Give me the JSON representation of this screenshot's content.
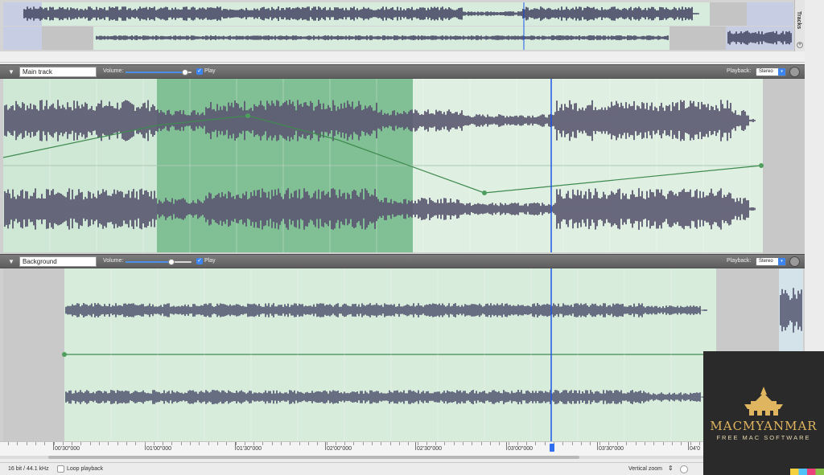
{
  "overview": {
    "tab_label": "Tracks"
  },
  "tracks": [
    {
      "name": "Main track",
      "volume_label": "Volume:",
      "volume_level": 0.9,
      "play_label": "Play",
      "play_checked": true,
      "playback_label": "Playback:",
      "playback_mode": "Stereo"
    },
    {
      "name": "Background",
      "volume_label": "Volume:",
      "volume_level": 0.7,
      "play_label": "Play",
      "play_checked": true,
      "playback_label": "Playback:",
      "playback_mode": "Stereo"
    }
  ],
  "ruler": {
    "labels": [
      "00'30\"000",
      "01'00\"000",
      "01'30\"000",
      "02'00\"000",
      "02'30\"000",
      "03'00\"000",
      "03'30\"000",
      "04'0"
    ]
  },
  "status": {
    "format": "16 bit / 44.1 kHz",
    "loop_label": "Loop playback",
    "vertical_zoom_label": "Vertical zoom"
  },
  "watermark": {
    "brand": "MACMYANMAR",
    "tagline": "FREE MAC SOFTWARE"
  },
  "colors": {
    "wave": "#5b5870",
    "wave_bg": "#5c6078",
    "track_fill": "#cfe8d6",
    "selection": "#2f9f5a",
    "playhead": "#1f57e8",
    "envelope": "#3f8a4f"
  }
}
